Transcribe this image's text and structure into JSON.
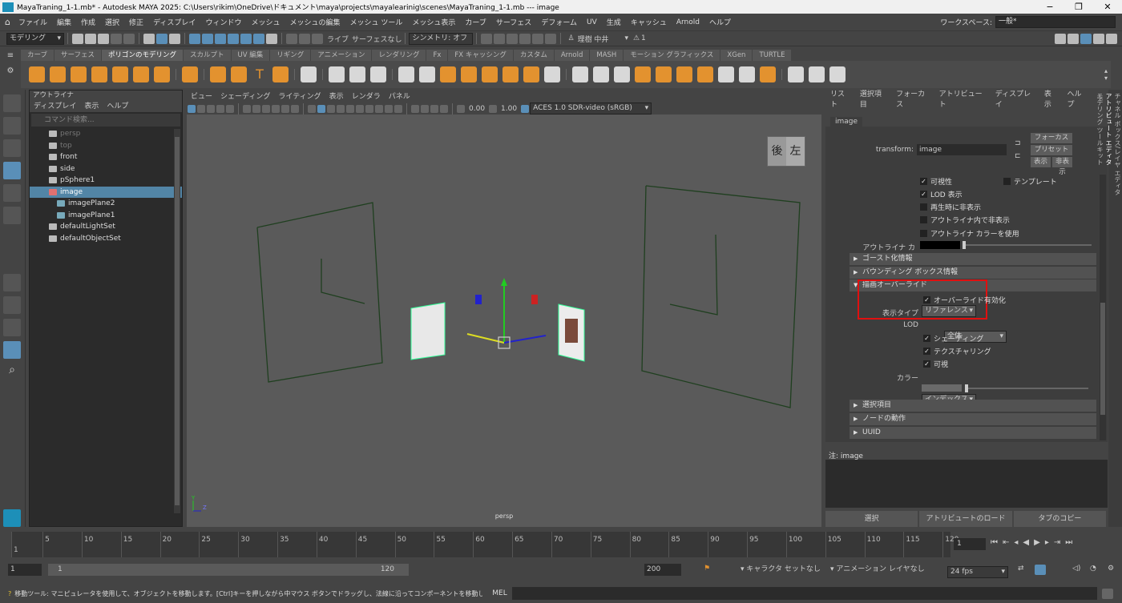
{
  "window": {
    "title": "MayaTraning_1-1.mb* - Autodesk MAYA 2025: C:\\Users\\rikim\\OneDrive\\ドキュメント\\maya\\projects\\mayalearinig\\scenes\\MayaTraning_1-1.mb  ---  image"
  },
  "menubar": {
    "items": [
      "ファイル",
      "編集",
      "作成",
      "選択",
      "修正",
      "ディスプレイ",
      "ウィンドウ",
      "メッシュ",
      "メッシュの編集",
      "メッシュ ツール",
      "メッシュ表示",
      "カーブ",
      "サーフェス",
      "デフォーム",
      "UV",
      "生成",
      "キャッシュ",
      "Arnold",
      "ヘルプ"
    ],
    "workspace_label": "ワークスペース:",
    "workspace_value": "一般*"
  },
  "statusline": {
    "mode": "モデリング",
    "live": "ライブ",
    "surface": "サーフェスなし",
    "symmetry": "シンメトリ: オフ",
    "user": "理樹 中井",
    "alerts": "1"
  },
  "shelf": {
    "tabs": [
      "カーブ",
      "サーフェス",
      "ポリゴンのモデリング",
      "スカルプト",
      "UV 編集",
      "リギング",
      "アニメーション",
      "レンダリング",
      "Fx",
      "FX キャッシング",
      "カスタム",
      "Arnold",
      "MASH",
      "モーション グラフィックス",
      "XGen",
      "TURTLE"
    ],
    "active_tab": "ポリゴンのモデリング"
  },
  "outliner": {
    "title": "アウトライナ",
    "menu": [
      "ディスプレイ",
      "表示",
      "ヘルプ"
    ],
    "search_placeholder": "コマンド検索...",
    "items": [
      {
        "label": "persp",
        "dim": true
      },
      {
        "label": "top",
        "dim": true
      },
      {
        "label": "front",
        "dim": false
      },
      {
        "label": "side",
        "dim": false
      },
      {
        "label": "pSphere1",
        "dim": false
      },
      {
        "label": "image",
        "dim": false,
        "selected": true
      },
      {
        "label": "imagePlane2",
        "dim": false,
        "child": true
      },
      {
        "label": "imagePlane1",
        "dim": false,
        "child": true
      },
      {
        "label": "defaultLightSet",
        "dim": false
      },
      {
        "label": "defaultObjectSet",
        "dim": false
      }
    ]
  },
  "viewport": {
    "menu": [
      "ビュー",
      "シェーディング",
      "ライティング",
      "表示",
      "レンダラ",
      "パネル"
    ],
    "exposure": "0.00",
    "gamma": "1.00",
    "colorspace": "ACES 1.0 SDR-video (sRGB)",
    "camera": "persp",
    "viewcube_back": "後",
    "viewcube_left": "左",
    "axis_y": "Y",
    "axis_z": "Z"
  },
  "attribute_editor": {
    "menu": [
      "リスト",
      "選択項目",
      "フォーカス",
      "アトリビュート",
      "ディスプレイ",
      "表示",
      "ヘルプ"
    ],
    "tab": "image",
    "transform_label": "transform:",
    "transform_value": "image",
    "focus_btn": "フォーカス",
    "preset_btn": "プリセット",
    "show_btn": "表示",
    "hide_btn": "非表示",
    "visibility": "可視性",
    "template": "テンプレート",
    "lod_visibility": "LOD 表示",
    "hide_on_playback": "再生時に非表示",
    "hide_in_outliner": "アウトライナ内で非表示",
    "use_outliner_color": "アウトライナ カラーを使用",
    "outliner_color_label": "アウトライナ カラー",
    "frames": {
      "ghosting": "ゴースト化情報",
      "bbox": "バウンディング ボックス情報",
      "draw_override": "描画オーバーライド",
      "selection": "選択項目",
      "node_behavior": "ノードの動作",
      "uuid": "UUID"
    },
    "override_enabled": "オーバーライド有効化",
    "display_type_label": "表示タイプ",
    "display_type_value": "リファレンス",
    "lod_label": "LOD",
    "lod_value": "全体",
    "shading": "シェーディング",
    "texturing": "テクスチャリング",
    "visible": "可視",
    "color_label": "カラー",
    "color_value": "インデックス",
    "notes_label": "注:",
    "notes_value": "image",
    "buttons": [
      "選択",
      "アトリビュートのロード",
      "タブのコピー"
    ],
    "highlight_color": "#e01010"
  },
  "side_tabs": [
    "チャネル ボックス/レイヤ エディタ",
    "アトリビュート エディタ",
    "モデリング ツールキット"
  ],
  "timeline": {
    "ticks": [
      "1",
      "5",
      "10",
      "15",
      "20",
      "25",
      "30",
      "35",
      "40",
      "45",
      "50",
      "55",
      "60",
      "65",
      "70",
      "75",
      "80",
      "85",
      "90",
      "95",
      "100",
      "105",
      "110",
      "115",
      "120"
    ],
    "current_frame": "1"
  },
  "range": {
    "start": "1",
    "inner_start": "1",
    "inner_end": "120",
    "end": "200",
    "char_set": "キャラクタ セットなし",
    "anim_layer": "アニメーション レイヤなし",
    "fps": "24 fps"
  },
  "helpline": {
    "text": "移動ツール: マニピュレータを使用して、オブジェクトを移動します。[Ctrl]キーを押しながら中マウス ボタンでドラッグし、法線に沿ってコンポーネントを移動します。[Shift]キーを押しながらマニピ",
    "mel": "MEL"
  }
}
